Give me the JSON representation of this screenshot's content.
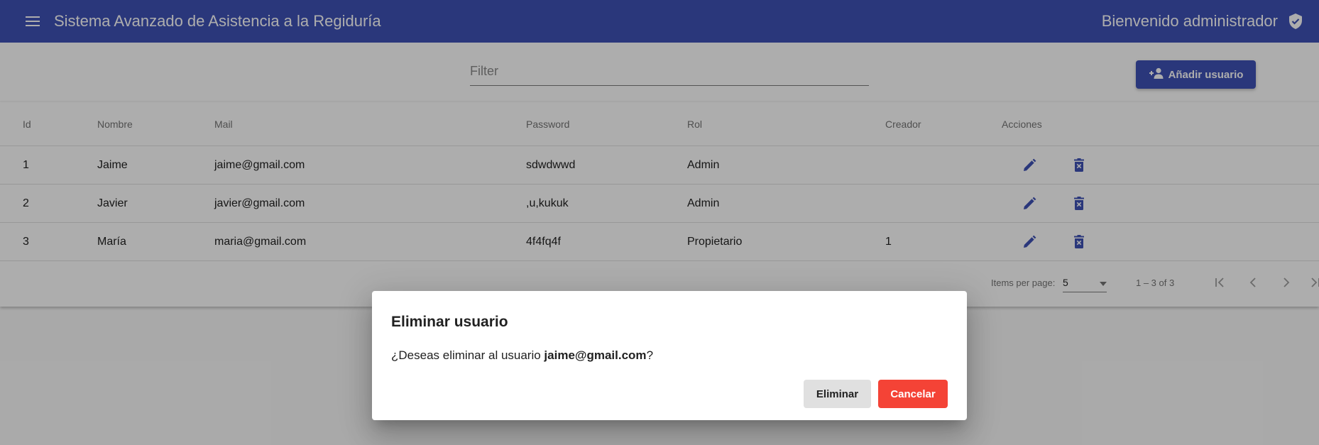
{
  "toolbar": {
    "title": "Sistema Avanzado de Asistencia a la Regiduría",
    "welcome": "Bienvenido administrador",
    "menu_icon": "menu-icon",
    "user_icon": "verified-user-icon",
    "color": "#3f51b5"
  },
  "filter": {
    "placeholder": "Filter",
    "value": ""
  },
  "add_button": {
    "label": "Añadir usuario",
    "icon": "person-add-icon"
  },
  "table": {
    "headers": {
      "id": "Id",
      "nombre": "Nombre",
      "mail": "Mail",
      "password": "Password",
      "rol": "Rol",
      "creador": "Creador",
      "acciones": "Acciones"
    },
    "rows": [
      {
        "id": "1",
        "nombre": "Jaime",
        "mail": "jaime@gmail.com",
        "password": "sdwdwwd",
        "rol": "Admin",
        "creador": ""
      },
      {
        "id": "2",
        "nombre": "Javier",
        "mail": "javier@gmail.com",
        "password": ",u,kukuk",
        "rol": "Admin",
        "creador": ""
      },
      {
        "id": "3",
        "nombre": "María",
        "mail": "maria@gmail.com",
        "password": "4f4fq4f",
        "rol": "Propietario",
        "creador": "1"
      }
    ],
    "action_icons": [
      "edit-icon",
      "delete-icon"
    ]
  },
  "paginator": {
    "items_per_page_label": "Items per page:",
    "page_size": "5",
    "range_label": "1 – 3 of 3"
  },
  "dialog": {
    "title": "Eliminar usuario",
    "message_prefix": "¿Deseas eliminar al usuario ",
    "email": "jaime@gmail.com",
    "message_suffix": "?",
    "confirm_label": "Eliminar",
    "cancel_label": "Cancelar",
    "cancel_color": "#f44336"
  }
}
